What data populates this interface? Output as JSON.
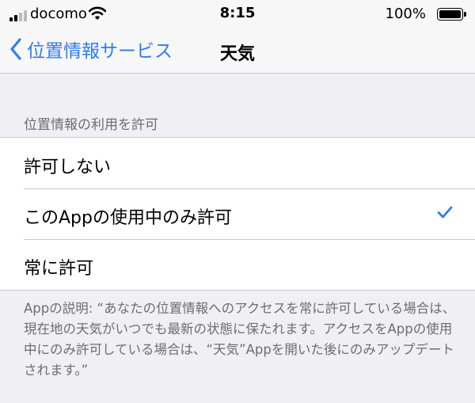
{
  "status_bar": {
    "carrier": "docomo",
    "time": "8:15",
    "battery_percent": "100%",
    "battery_level": 1.0
  },
  "nav": {
    "back_label": "位置情報サービス",
    "title": "天気"
  },
  "section": {
    "header": "位置情報の利用を許可",
    "options": [
      {
        "label": "許可しない",
        "selected": false
      },
      {
        "label": "このAppの使用中のみ許可",
        "selected": true
      },
      {
        "label": "常に許可",
        "selected": false
      }
    ]
  },
  "description": "Appの説明: “あなたの位置情報へのアクセスを常に許可している場合は、現在地の天気がいつでも最新の状態に保たれます。アクセスをAppの使用中にのみ許可している場合は、“天気”Appを開いた後にのみアップデートされます。”",
  "colors": {
    "accent": "#2e7cf6",
    "background": "#efeff4",
    "secondary_text": "#6d6d72"
  }
}
